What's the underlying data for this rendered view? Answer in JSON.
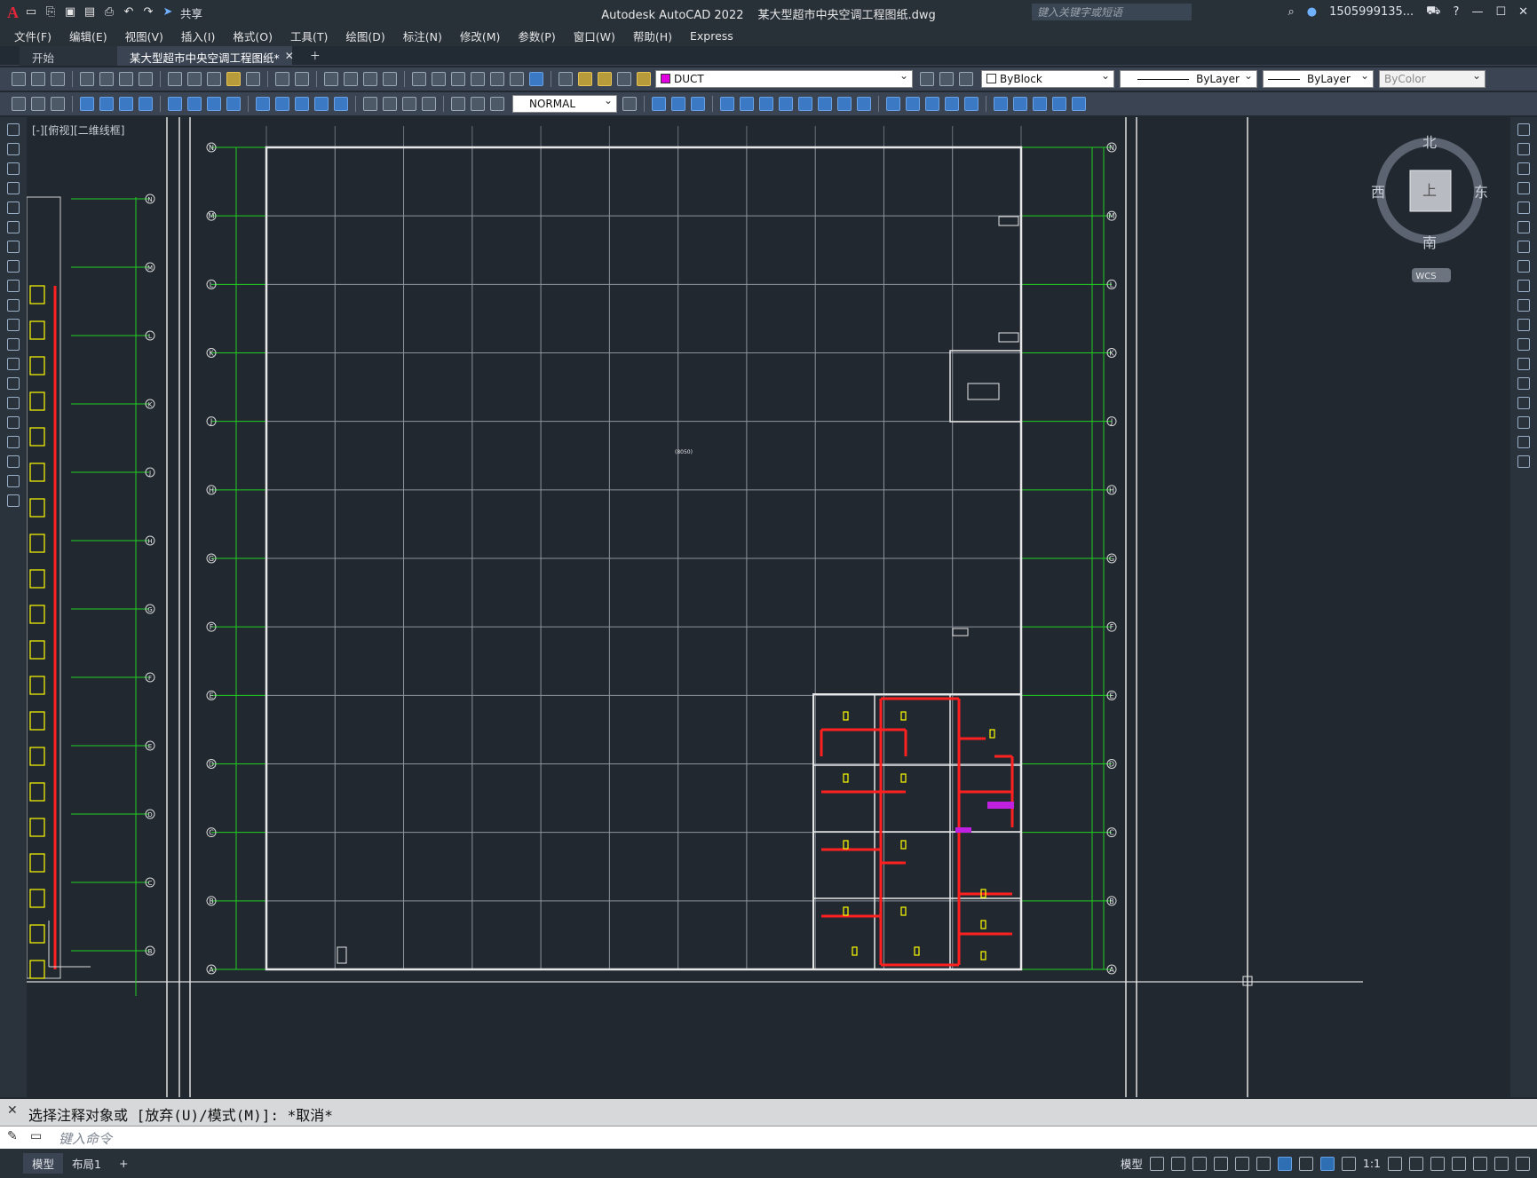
{
  "app": {
    "title": "Autodesk AutoCAD 2022",
    "file": "某大型超市中央空调工程图纸.dwg",
    "share_label": "共享",
    "search_placeholder": "键入关键字或短语",
    "user": "1505999135..."
  },
  "menus": [
    "文件(F)",
    "编辑(E)",
    "视图(V)",
    "插入(I)",
    "格式(O)",
    "工具(T)",
    "绘图(D)",
    "标注(N)",
    "修改(M)",
    "参数(P)",
    "窗口(W)",
    "帮助(H)",
    "Express"
  ],
  "tabs": [
    {
      "label": "开始",
      "active": false
    },
    {
      "label": "某大型超市中央空调工程图纸*",
      "active": true
    }
  ],
  "properties": {
    "layer": "DUCT",
    "layer_color": "#e000e0",
    "color": "ByBlock",
    "linetype": "ByLayer",
    "lineweight": "ByLayer",
    "plotstyle": "ByColor",
    "dimstyle": "NORMAL"
  },
  "viewport": {
    "label": "[-][俯视][二维线框]",
    "viewcube": {
      "north": "北",
      "south": "南",
      "east": "东",
      "west": "西",
      "top": "上",
      "wcs": "WCS"
    }
  },
  "drawing": {
    "axes_rows": [
      "N",
      "M",
      "L",
      "K",
      "J",
      "H",
      "G",
      "F",
      "E",
      "D",
      "C",
      "B",
      "A"
    ],
    "center_label": "(8050)"
  },
  "command": {
    "history": "选择注释对象或 [放弃(U)/模式(M)]: *取消*",
    "placeholder": "键入命令"
  },
  "status": {
    "model_tab": "模型",
    "layout_tab": "布局1",
    "add_tab": "+",
    "model_label": "模型",
    "scale": "1:1"
  }
}
